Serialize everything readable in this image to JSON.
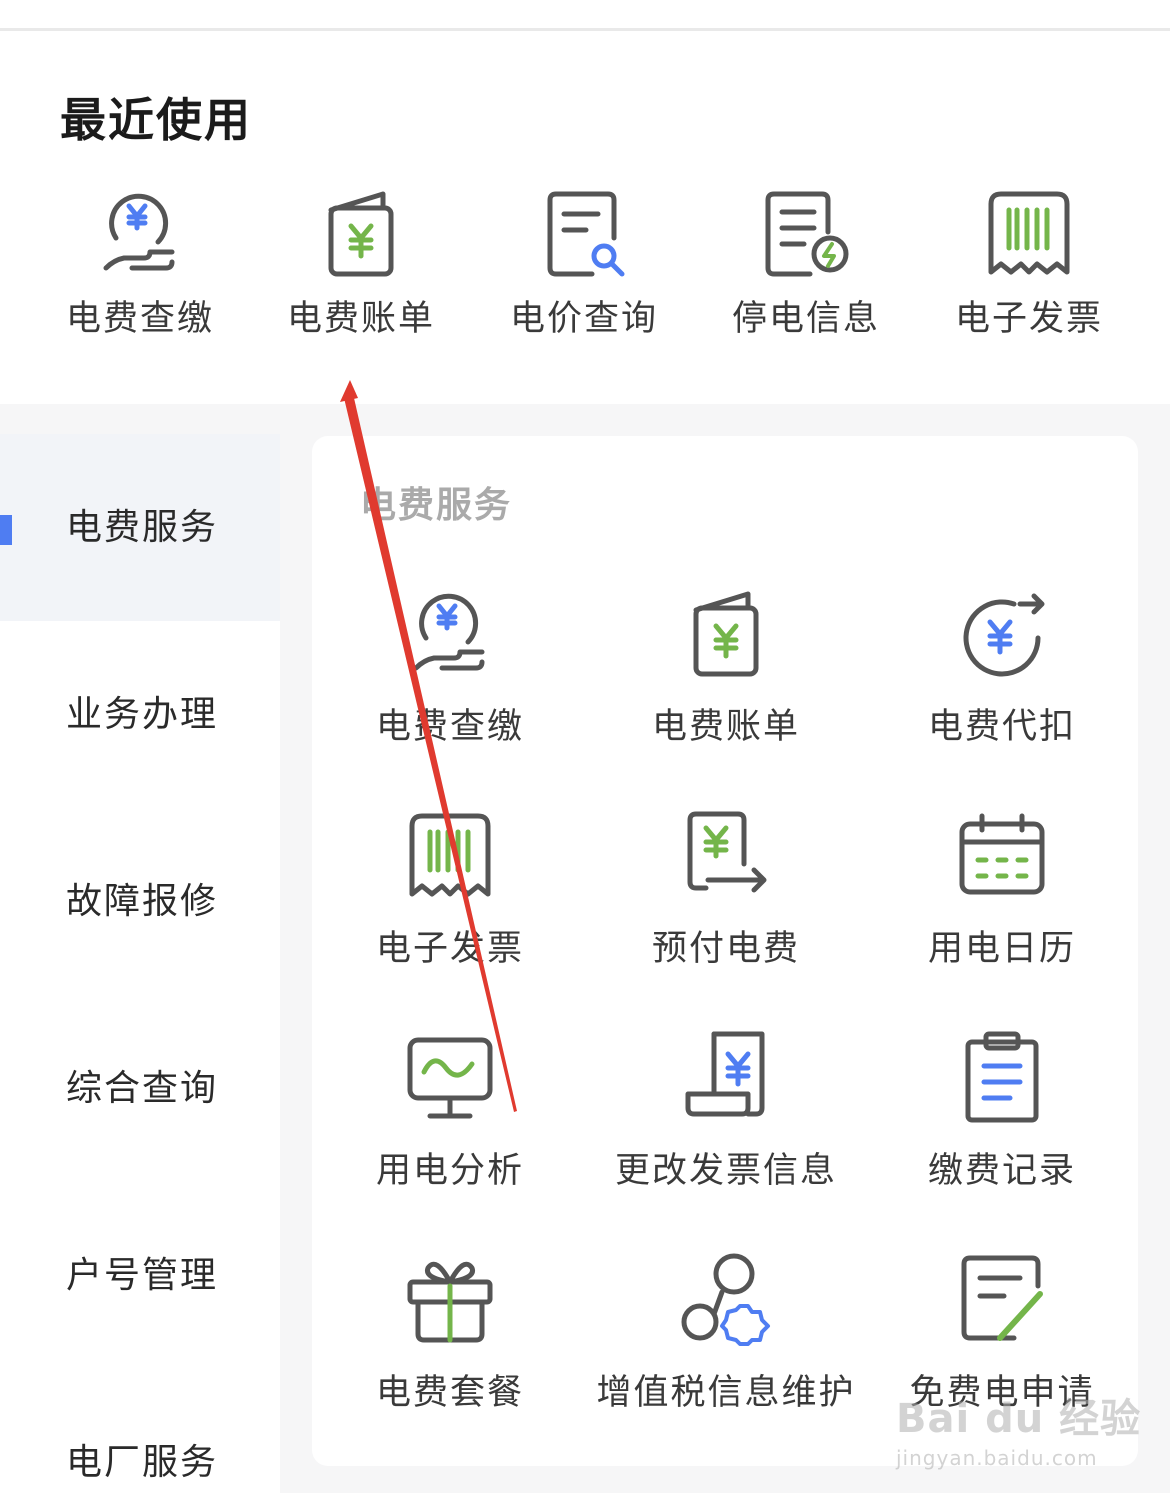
{
  "recent": {
    "title": "最近使用",
    "items": [
      {
        "label": "电费查缴",
        "icon": "yuan-coin-hand-icon"
      },
      {
        "label": "电费账单",
        "icon": "yuan-bill-book-icon"
      },
      {
        "label": "电价查询",
        "icon": "document-search-icon"
      },
      {
        "label": "停电信息",
        "icon": "document-lightning-icon"
      },
      {
        "label": "电子发票",
        "icon": "barcode-receipt-icon"
      }
    ]
  },
  "sidebar": {
    "items": [
      {
        "label": "电费服务",
        "active": true
      },
      {
        "label": "业务办理"
      },
      {
        "label": "故障报修"
      },
      {
        "label": "综合查询"
      },
      {
        "label": "户号管理"
      },
      {
        "label": "电厂服务"
      }
    ]
  },
  "services": {
    "section_title": "电费服务",
    "items": [
      {
        "label": "电费查缴",
        "icon": "yuan-coin-hand-icon"
      },
      {
        "label": "电费账单",
        "icon": "yuan-bill-book-icon"
      },
      {
        "label": "电费代扣",
        "icon": "yuan-cycle-icon"
      },
      {
        "label": "电子发票",
        "icon": "barcode-receipt-icon"
      },
      {
        "label": "预付电费",
        "icon": "prepay-yuan-arrow-icon"
      },
      {
        "label": "用电日历",
        "icon": "calendar-icon"
      },
      {
        "label": "用电分析",
        "icon": "monitor-wave-icon"
      },
      {
        "label": "更改发票信息",
        "icon": "yuan-scroll-icon"
      },
      {
        "label": "缴费记录",
        "icon": "clipboard-list-icon"
      },
      {
        "label": "电费套餐",
        "icon": "gift-icon"
      },
      {
        "label": "增值税信息维护",
        "icon": "user-gear-icon"
      },
      {
        "label": "免费电申请",
        "icon": "document-pen-icon"
      }
    ]
  },
  "watermark": {
    "main": "Bai du 经验",
    "sub": "jingyan.baidu.com"
  },
  "colors": {
    "icon_stroke": "#555555",
    "icon_blue": "#4f7df2",
    "icon_green": "#74b54a",
    "annotation_arrow": "#e03a2f",
    "sidebar_marker": "#4f7df2"
  }
}
